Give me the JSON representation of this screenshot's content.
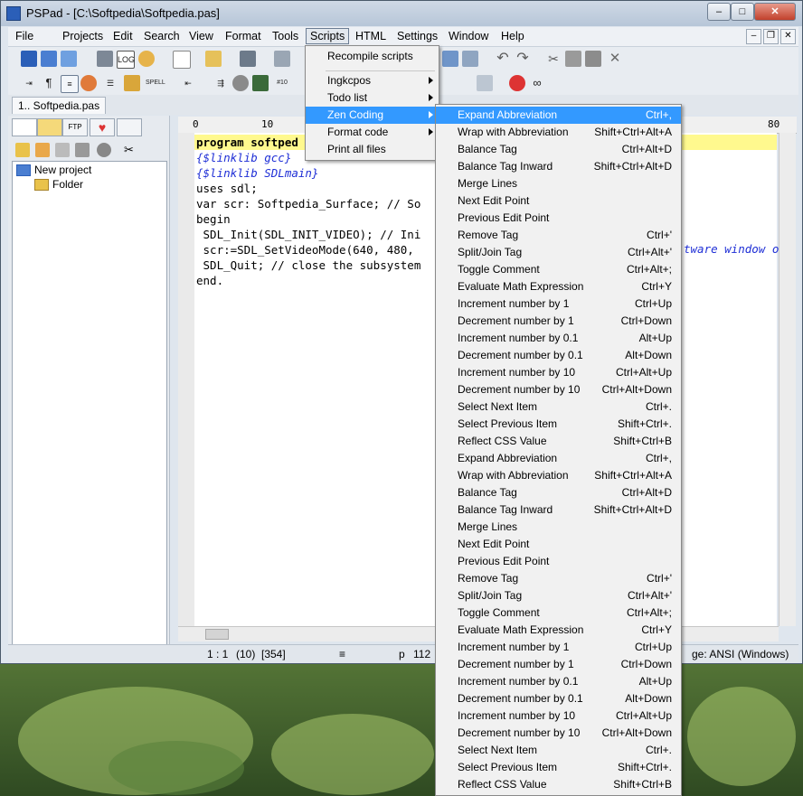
{
  "window": {
    "title": "PSPad - [C:\\Softpedia\\Softpedia.pas]"
  },
  "menubar": {
    "items": [
      "File",
      "Projects",
      "Edit",
      "Search",
      "View",
      "Format",
      "Tools",
      "Scripts",
      "HTML",
      "Settings",
      "Window",
      "Help"
    ]
  },
  "doc_tab": {
    "label": "1.. Softpedia.pas"
  },
  "project_tree": {
    "root": "New project",
    "child": "Folder"
  },
  "ruler": {
    "marks": [
      "0",
      "10",
      "80"
    ]
  },
  "editor": {
    "lines": [
      "program softped",
      "{$linklib gcc}",
      "{$linklib SDLmain}",
      "uses sdl;",
      "var scr: Softpedia_Surface; // So",
      "begin",
      " SDL_Init(SDL_INIT_VIDEO); // Ini",
      " scr:=SDL_SetVideoMode(640, 480,",
      " SDL_Quit; // close the subsystem",
      "end."
    ],
    "overflow_fragment": "tware window o"
  },
  "statusbar": {
    "position": "1 : 1",
    "col": "(10)",
    "size": "[354]",
    "page": "p",
    "count": "112",
    "encoding": "ge: ANSI (Windows)"
  },
  "scripts_menu": {
    "items": [
      {
        "label": "Recompile scripts",
        "submenu": false
      },
      {
        "label": "Ingkcpos",
        "submenu": true
      },
      {
        "label": "Todo list",
        "submenu": true
      },
      {
        "label": "Zen Coding",
        "submenu": true,
        "active": true
      },
      {
        "label": "Format code",
        "submenu": true
      },
      {
        "label": "Print all files",
        "submenu": false
      }
    ]
  },
  "zen_menu": {
    "items": [
      {
        "label": "Expand Abbreviation",
        "shortcut": "Ctrl+,"
      },
      {
        "label": "Wrap with Abbreviation",
        "shortcut": "Shift+Ctrl+Alt+A"
      },
      {
        "label": "Balance Tag",
        "shortcut": "Ctrl+Alt+D"
      },
      {
        "label": "Balance Tag Inward",
        "shortcut": "Shift+Ctrl+Alt+D"
      },
      {
        "label": "Merge Lines",
        "shortcut": ""
      },
      {
        "label": "Next Edit Point",
        "shortcut": ""
      },
      {
        "label": "Previous Edit Point",
        "shortcut": ""
      },
      {
        "label": "Remove Tag",
        "shortcut": "Ctrl+'"
      },
      {
        "label": "Split/Join Tag",
        "shortcut": "Ctrl+Alt+'"
      },
      {
        "label": "Toggle Comment",
        "shortcut": "Ctrl+Alt+;"
      },
      {
        "label": "Evaluate Math Expression",
        "shortcut": "Ctrl+Y"
      },
      {
        "label": "Increment number by 1",
        "shortcut": "Ctrl+Up"
      },
      {
        "label": "Decrement number by 1",
        "shortcut": "Ctrl+Down"
      },
      {
        "label": "Increment number by 0.1",
        "shortcut": "Alt+Up"
      },
      {
        "label": "Decrement number by 0.1",
        "shortcut": "Alt+Down"
      },
      {
        "label": "Increment number by 10",
        "shortcut": "Ctrl+Alt+Up"
      },
      {
        "label": "Decrement number by 10",
        "shortcut": "Ctrl+Alt+Down"
      },
      {
        "label": "Select Next Item",
        "shortcut": "Ctrl+."
      },
      {
        "label": "Select Previous Item",
        "shortcut": "Shift+Ctrl+."
      },
      {
        "label": "Reflect CSS Value",
        "shortcut": "Shift+Ctrl+B"
      },
      {
        "label": "Expand Abbreviation",
        "shortcut": "Ctrl+,"
      },
      {
        "label": "Wrap with Abbreviation",
        "shortcut": "Shift+Ctrl+Alt+A"
      },
      {
        "label": "Balance Tag",
        "shortcut": "Ctrl+Alt+D"
      },
      {
        "label": "Balance Tag Inward",
        "shortcut": "Shift+Ctrl+Alt+D"
      },
      {
        "label": "Merge Lines",
        "shortcut": ""
      },
      {
        "label": "Next Edit Point",
        "shortcut": ""
      },
      {
        "label": "Previous Edit Point",
        "shortcut": ""
      },
      {
        "label": "Remove Tag",
        "shortcut": "Ctrl+'"
      },
      {
        "label": "Split/Join Tag",
        "shortcut": "Ctrl+Alt+'"
      },
      {
        "label": "Toggle Comment",
        "shortcut": "Ctrl+Alt+;"
      },
      {
        "label": "Evaluate Math Expression",
        "shortcut": "Ctrl+Y"
      },
      {
        "label": "Increment number by 1",
        "shortcut": "Ctrl+Up"
      },
      {
        "label": "Decrement number by 1",
        "shortcut": "Ctrl+Down"
      },
      {
        "label": "Increment number by 0.1",
        "shortcut": "Alt+Up"
      },
      {
        "label": "Decrement number by 0.1",
        "shortcut": "Alt+Down"
      },
      {
        "label": "Increment number by 10",
        "shortcut": "Ctrl+Alt+Up"
      },
      {
        "label": "Decrement number by 10",
        "shortcut": "Ctrl+Alt+Down"
      },
      {
        "label": "Select Next Item",
        "shortcut": "Ctrl+."
      },
      {
        "label": "Select Previous Item",
        "shortcut": "Shift+Ctrl+."
      },
      {
        "label": "Reflect CSS Value",
        "shortcut": "Shift+Ctrl+B"
      }
    ]
  },
  "colors": {
    "menu_highlight": "#3399ff",
    "current_line": "#fff98e",
    "comment": "#1f2fd6"
  }
}
